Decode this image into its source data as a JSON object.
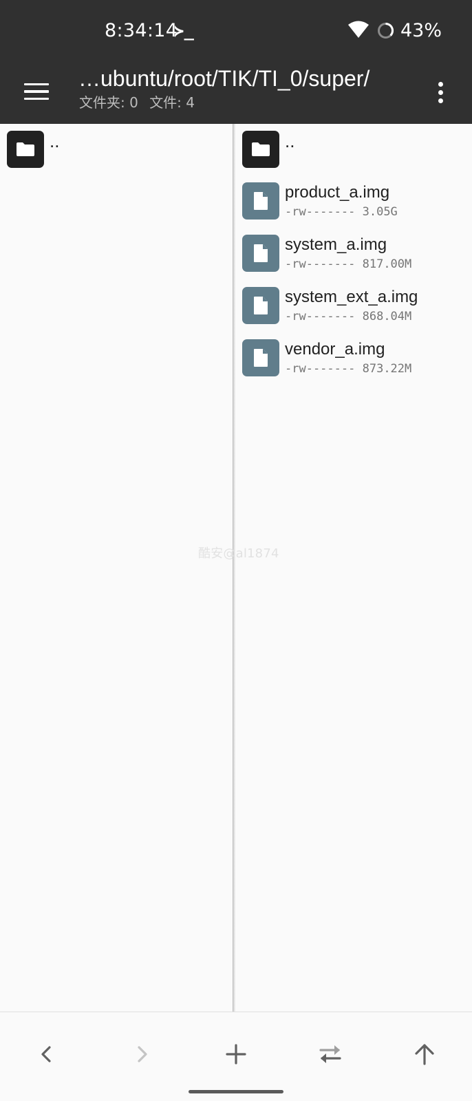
{
  "status_bar": {
    "time": "8:34:14",
    "terminal_glyph": "≻_",
    "battery_percent": "43%",
    "icons": [
      "wifi-icon",
      "battery-saver-icon"
    ]
  },
  "app_bar": {
    "path": "…ubuntu/root/TIK/TI_0/super/",
    "folder_count_label": "文件夹: 0",
    "file_count_label": "文件: 4",
    "icons": [
      "menu-icon",
      "more-vert-icon"
    ]
  },
  "left_pane": {
    "items": [
      {
        "name": "..",
        "type": "parent-folder"
      }
    ]
  },
  "right_pane": {
    "items": [
      {
        "name": "..",
        "type": "parent-folder"
      },
      {
        "name": "product_a.img",
        "type": "file",
        "permissions": "-rw-------",
        "size": "3.05G"
      },
      {
        "name": "system_a.img",
        "type": "file",
        "permissions": "-rw-------",
        "size": "817.00M"
      },
      {
        "name": "system_ext_a.img",
        "type": "file",
        "permissions": "-rw-------",
        "size": "868.04M"
      },
      {
        "name": "vendor_a.img",
        "type": "file",
        "permissions": "-rw-------",
        "size": "873.22M"
      }
    ]
  },
  "watermark": "酷安@al1874",
  "toolbar": {
    "icons": [
      "back-icon",
      "forward-icon",
      "add-icon",
      "swap-icon",
      "up-icon"
    ]
  },
  "colors": {
    "bar_background": "#303030",
    "folder_thumb": "#212121",
    "file_thumb": "#607d8b",
    "pane_background": "#fafafa"
  }
}
